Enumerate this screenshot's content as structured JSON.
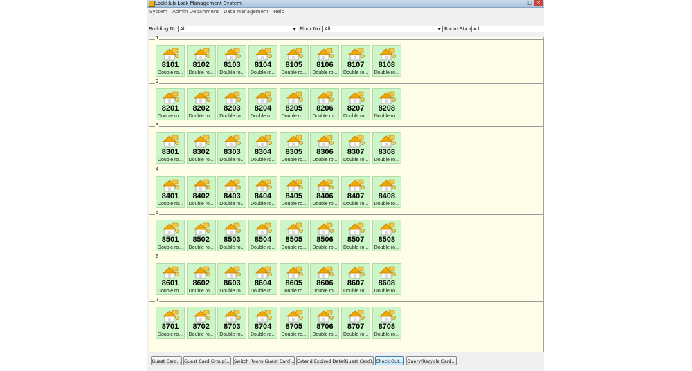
{
  "window": {
    "title": "LockHub Lock Management System",
    "close_glyph": "×",
    "minimize_glyph": "–",
    "maximize_glyph": "□"
  },
  "menu": [
    "System",
    "Admin Department",
    "Data Management",
    "Help"
  ],
  "filters": {
    "building": {
      "label": "Building No.:",
      "value": "All"
    },
    "floor": {
      "label": "Floor No.:",
      "value": "All"
    },
    "state": {
      "label": "Room State:",
      "value": "All"
    }
  },
  "floors": [
    {
      "label": "1",
      "rooms": [
        {
          "number": "8101",
          "type": "Double ro..."
        },
        {
          "number": "8102",
          "type": "Double ro..."
        },
        {
          "number": "8103",
          "type": "Double ro..."
        },
        {
          "number": "8104",
          "type": "Double ro..."
        },
        {
          "number": "8105",
          "type": "Double ro..."
        },
        {
          "number": "8106",
          "type": "Double ro..."
        },
        {
          "number": "8107",
          "type": "Double ro..."
        },
        {
          "number": "8108",
          "type": "Double ro..."
        }
      ]
    },
    {
      "label": "2",
      "rooms": [
        {
          "number": "8201",
          "type": "Double ro..."
        },
        {
          "number": "8202",
          "type": "Double ro..."
        },
        {
          "number": "8203",
          "type": "Double ro..."
        },
        {
          "number": "8204",
          "type": "Double ro..."
        },
        {
          "number": "8205",
          "type": "Double ro..."
        },
        {
          "number": "8206",
          "type": "Double ro..."
        },
        {
          "number": "8207",
          "type": "Double ro..."
        },
        {
          "number": "8208",
          "type": "Double ro..."
        }
      ]
    },
    {
      "label": "3",
      "rooms": [
        {
          "number": "8301",
          "type": "Double ro..."
        },
        {
          "number": "8302",
          "type": "Double ro..."
        },
        {
          "number": "8303",
          "type": "Double ro..."
        },
        {
          "number": "8304",
          "type": "Double ro..."
        },
        {
          "number": "8305",
          "type": "Double ro..."
        },
        {
          "number": "8306",
          "type": "Double ro..."
        },
        {
          "number": "8307",
          "type": "Double ro..."
        },
        {
          "number": "8308",
          "type": "Double ro..."
        }
      ]
    },
    {
      "label": "4",
      "rooms": [
        {
          "number": "8401",
          "type": "Double ro..."
        },
        {
          "number": "8402",
          "type": "Double ro..."
        },
        {
          "number": "8403",
          "type": "Double ro..."
        },
        {
          "number": "8404",
          "type": "Double ro..."
        },
        {
          "number": "8405",
          "type": "Double ro..."
        },
        {
          "number": "8406",
          "type": "Double ro..."
        },
        {
          "number": "8407",
          "type": "Double ro..."
        },
        {
          "number": "8408",
          "type": "Double ro..."
        }
      ]
    },
    {
      "label": "5",
      "rooms": [
        {
          "number": "8501",
          "type": "Double ro..."
        },
        {
          "number": "8502",
          "type": "Double ro..."
        },
        {
          "number": "8503",
          "type": "Double ro..."
        },
        {
          "number": "8504",
          "type": "Double ro..."
        },
        {
          "number": "8505",
          "type": "Double ro..."
        },
        {
          "number": "8506",
          "type": "Double ro..."
        },
        {
          "number": "8507",
          "type": "Double ro..."
        },
        {
          "number": "8508",
          "type": "Double ro..."
        }
      ]
    },
    {
      "label": "6",
      "rooms": [
        {
          "number": "8601",
          "type": "Double ro..."
        },
        {
          "number": "8602",
          "type": "Double ro..."
        },
        {
          "number": "8603",
          "type": "Double ro..."
        },
        {
          "number": "8604",
          "type": "Double ro..."
        },
        {
          "number": "8605",
          "type": "Double ro..."
        },
        {
          "number": "8606",
          "type": "Double ro..."
        },
        {
          "number": "8607",
          "type": "Double ro..."
        },
        {
          "number": "8608",
          "type": "Double ro..."
        }
      ]
    },
    {
      "label": "7",
      "rooms": [
        {
          "number": "8701",
          "type": "Double ro..."
        },
        {
          "number": "8702",
          "type": "Double ro..."
        },
        {
          "number": "8703",
          "type": "Double ro..."
        },
        {
          "number": "8704",
          "type": "Double ro..."
        },
        {
          "number": "8705",
          "type": "Double ro..."
        },
        {
          "number": "8706",
          "type": "Double ro..."
        },
        {
          "number": "8707",
          "type": "Double ro..."
        },
        {
          "number": "8708",
          "type": "Double ro..."
        }
      ]
    }
  ],
  "room_icon": "house-key-icon",
  "colors": {
    "tile_bg": "#ccf5c8",
    "room_area_bg": "#fefee8",
    "roof": "#f0a800"
  },
  "buttons": [
    {
      "label": "Guest Card...",
      "name": "guest-card-button"
    },
    {
      "label": "Guest Card(Group)...",
      "name": "guest-card-group-button"
    },
    {
      "label": "Switch Room(Guest Card)...",
      "name": "switch-room-button"
    },
    {
      "label": "Extend Expired Date(Guest Card)...",
      "name": "extend-expired-date-button"
    },
    {
      "label": "Check Out...",
      "name": "check-out-button"
    },
    {
      "label": "Query/Recycle Card...",
      "name": "query-recycle-card-button"
    }
  ]
}
